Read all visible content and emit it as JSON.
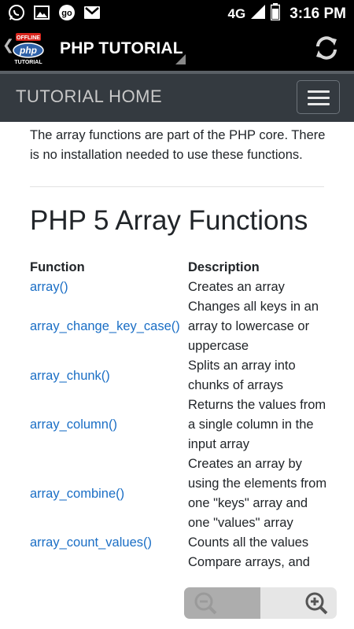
{
  "status_bar": {
    "icons": [
      "whatsapp-icon",
      "gallery-icon",
      "go-icon",
      "gmail-icon"
    ],
    "network": "4G",
    "time": "3:16 PM"
  },
  "action_bar": {
    "logo": {
      "badge": "OFFLINE",
      "text": "php",
      "sub": "TUTORIAL"
    },
    "title": "PHP TUTORIAL",
    "refresh_icon": "refresh-icon"
  },
  "nav_bar": {
    "title": "TUTORIAL HOME",
    "menu_icon": "hamburger-menu-icon"
  },
  "content": {
    "intro": "The array functions are part of the PHP core. There is no installation needed to use these functions.",
    "heading": "PHP 5 Array Functions",
    "table": {
      "headers": {
        "function": "Function",
        "description": "Description"
      },
      "rows": [
        {
          "fn": "array()",
          "desc": "Creates an array"
        },
        {
          "fn": "array_change_key_case()",
          "desc": "Changes all keys in an array to lowercase or uppercase"
        },
        {
          "fn": "array_chunk()",
          "desc": "Splits an array into chunks of arrays"
        },
        {
          "fn": "array_column()",
          "desc": "Returns the values from a single column in the input array"
        },
        {
          "fn": "array_combine()",
          "desc": "Creates an array by using the elements from one \"keys\" array and one \"values\" array"
        },
        {
          "fn": "array_count_values()",
          "desc": "Counts all the values"
        },
        {
          "fn": "",
          "desc": "Compare arrays, and"
        }
      ]
    }
  },
  "zoom": {
    "out_icon": "zoom-out-icon",
    "in_icon": "zoom-in-icon"
  },
  "colors": {
    "link": "#1a6ec5",
    "navbar": "#343a40",
    "actionbar": "#000000"
  }
}
